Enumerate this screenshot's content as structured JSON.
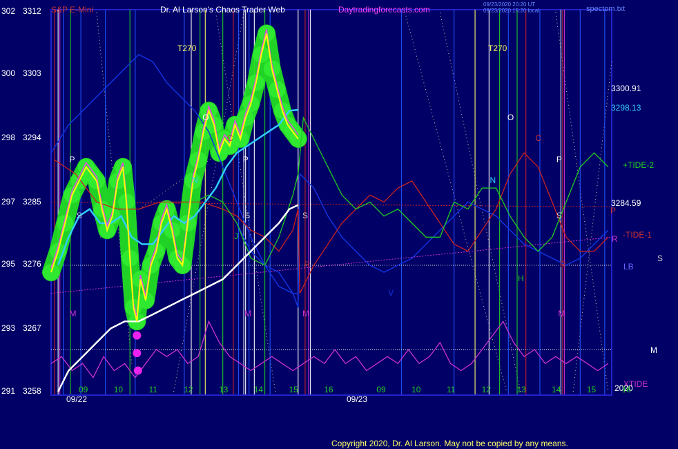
{
  "header": {
    "symbol": "S&P E-Mini",
    "title": "Dr. Al Larson's Chaos Trader Web",
    "site": "Daytradingforecasts.com",
    "timestamp_utc": "09/23/2020 20:20 UT",
    "timestamp_local": "09/23/2020 15:20 local",
    "chart_file": "spectom.txt"
  },
  "footer": {
    "copyright": "Copyright 2020, Dr. Al Larson. May not be copied by any means."
  },
  "colors": {
    "background": "#000066",
    "frame": "#2222cc",
    "price_line": "#ffff00",
    "price_glow": "#22dd22",
    "fast_ma": "#33ccff",
    "slow_ma": "#ffffff",
    "tide_green": "#22cc22",
    "tide_red": "#cc2222",
    "tide_magenta": "#cc33cc",
    "blue_curve": "#1133dd"
  },
  "chart_data": {
    "type": "line",
    "title": "S&P E-Mini",
    "ylim": [
      3258,
      3312
    ],
    "y_ticks": [
      {
        "left": "302",
        "right": "3312",
        "value": 3312
      },
      {
        "left": "300",
        "right": "3303",
        "value": 3303
      },
      {
        "left": "298",
        "right": "3294",
        "value": 3294
      },
      {
        "left": "297",
        "right": "3285",
        "value": 3285
      },
      {
        "left": "295",
        "right": "3276",
        "value": 3276
      },
      {
        "left": "293",
        "right": "3267",
        "value": 3267
      },
      {
        "left": "291",
        "right": "3258",
        "value": 3258
      }
    ],
    "x_ticks": [
      {
        "label": "09",
        "x": 8.5
      },
      {
        "label": "10",
        "x": 9.5
      },
      {
        "label": "11",
        "x": 10.5
      },
      {
        "label": "12",
        "x": 11.5
      },
      {
        "label": "13",
        "x": 12.5
      },
      {
        "label": "14",
        "x": 13.5
      },
      {
        "label": "15",
        "x": 14.5
      },
      {
        "label": "16",
        "x": 15.5
      },
      {
        "label": "09",
        "x": 17
      },
      {
        "label": "10",
        "x": 18
      },
      {
        "label": "11",
        "x": 19
      },
      {
        "label": "12",
        "x": 20
      },
      {
        "label": "13",
        "x": 21
      },
      {
        "label": "14",
        "x": 22
      },
      {
        "label": "15",
        "x": 23
      },
      {
        "label": "16",
        "x": 24
      }
    ],
    "date_labels": [
      {
        "label": "09/22",
        "x": 8.5
      },
      {
        "label": "09/23",
        "x": 17
      }
    ],
    "year_label": "2020",
    "xlim": [
      8.5,
      24.5
    ],
    "price_series": {
      "name": "S&P E-Mini",
      "x": [
        8.5,
        8.7,
        8.9,
        9.1,
        9.3,
        9.5,
        9.65,
        9.8,
        9.95,
        10.1,
        10.25,
        10.4,
        10.55,
        10.65,
        10.75,
        10.85,
        10.95,
        11.05,
        11.2,
        11.35,
        11.5,
        11.65,
        11.8,
        11.95,
        12.1,
        12.25,
        12.4,
        12.55,
        12.7,
        12.85,
        13.0,
        13.15,
        13.3,
        13.45,
        13.6,
        13.75,
        13.9,
        14.05,
        14.2,
        14.35,
        14.5,
        14.65,
        14.8,
        14.95,
        15.1,
        15.25,
        15.4,
        15.55
      ],
      "values": [
        3275,
        3278,
        3282,
        3286,
        3288,
        3290,
        3289,
        3288,
        3284,
        3281,
        3283,
        3288,
        3290,
        3285,
        3277,
        3270,
        3268,
        3274,
        3271,
        3276,
        3278,
        3282,
        3284,
        3281,
        3277,
        3276,
        3282,
        3288,
        3291,
        3295,
        3298,
        3296,
        3292,
        3294,
        3293,
        3296,
        3294,
        3297,
        3299,
        3302,
        3306,
        3309,
        3304,
        3301,
        3298,
        3296,
        3295,
        3294
      ]
    },
    "fast_ma": {
      "name": "3298.13",
      "x": [
        8.7,
        9.0,
        9.3,
        9.6,
        9.9,
        10.2,
        10.5,
        10.8,
        11.1,
        11.4,
        11.7,
        12.0,
        12.3,
        12.6,
        12.9,
        13.2,
        13.5,
        13.8,
        14.1,
        14.4,
        14.7,
        15.0,
        15.3,
        15.55
      ],
      "values": [
        3276,
        3280,
        3283,
        3284,
        3282,
        3282,
        3283,
        3280,
        3279,
        3279,
        3281,
        3283,
        3282,
        3283,
        3285,
        3287,
        3290,
        3292,
        3293,
        3294,
        3295,
        3296,
        3298,
        3298.13
      ]
    },
    "slow_ma": {
      "name": "3284.59",
      "x": [
        8.7,
        9.0,
        9.4,
        9.8,
        10.2,
        10.6,
        11.0,
        11.4,
        11.8,
        12.2,
        12.6,
        13.0,
        13.4,
        13.8,
        14.2,
        14.6,
        15.0,
        15.3,
        15.55
      ],
      "values": [
        3258,
        3261,
        3263,
        3265,
        3267,
        3268,
        3268,
        3269,
        3270,
        3271,
        3272,
        3273,
        3274,
        3276,
        3278,
        3280,
        3282,
        3284,
        3284.59
      ]
    },
    "annotations": [
      {
        "text": "3300.91",
        "color": "#ffffff"
      },
      {
        "text": "3298.13",
        "color": "#33ccff"
      },
      {
        "text": "3284.59",
        "color": "#ffffff"
      },
      {
        "text": "+TIDE-2",
        "color": "#22cc22"
      },
      {
        "text": "-TIDE-1",
        "color": "#cc3333"
      },
      {
        "text": "XTIDE",
        "color": "#cc33cc"
      },
      {
        "text": "LB",
        "color": "#6666ff"
      },
      {
        "text": "S",
        "color": "#cccccc"
      },
      {
        "text": "P",
        "color": "#ffffff"
      },
      {
        "text": "R",
        "color": "#cc3333"
      },
      {
        "text": "M",
        "color": "#cc33cc"
      },
      {
        "text": "T270",
        "color": "#ffff66"
      },
      {
        "text": "T270",
        "color": "#ffff66"
      }
    ],
    "markers": [
      {
        "text": "P",
        "x": 9.1,
        "y": 3291,
        "color": "#ffffff"
      },
      {
        "text": "S",
        "x": 9.3,
        "y": 3283,
        "color": "#cccccc"
      },
      {
        "text": "M",
        "x": 9.1,
        "y": 3269,
        "color": "#cc33cc"
      },
      {
        "text": "O",
        "x": 12.9,
        "y": 3297,
        "color": "#ffffff"
      },
      {
        "text": "N",
        "x": 12.6,
        "y": 3288,
        "color": "#33ccff"
      },
      {
        "text": "C",
        "x": 13.6,
        "y": 3294,
        "color": "#cc3333"
      },
      {
        "text": "P",
        "x": 14.05,
        "y": 3291,
        "color": "#ffffff"
      },
      {
        "text": "S",
        "x": 14.1,
        "y": 3283,
        "color": "#cccccc"
      },
      {
        "text": "J",
        "x": 13.8,
        "y": 3280,
        "color": "#22cc22"
      },
      {
        "text": "M",
        "x": 14.1,
        "y": 3269,
        "color": "#cc33cc"
      },
      {
        "text": "S",
        "x": 15.75,
        "y": 3283,
        "color": "#cccccc"
      },
      {
        "text": "M",
        "x": 15.75,
        "y": 3269,
        "color": "#cc33cc"
      },
      {
        "text": "R",
        "x": 15.8,
        "y": 3276,
        "color": "#cc3333"
      },
      {
        "text": "V",
        "x": 18.2,
        "y": 3272,
        "color": "#1133dd"
      },
      {
        "text": "O",
        "x": 21.6,
        "y": 3297,
        "color": "#ffffff"
      },
      {
        "text": "N",
        "x": 21.1,
        "y": 3288,
        "color": "#33ccff"
      },
      {
        "text": "C",
        "x": 22.4,
        "y": 3294,
        "color": "#cc3333"
      },
      {
        "text": "H",
        "x": 21.9,
        "y": 3274,
        "color": "#22cc22"
      },
      {
        "text": "P",
        "x": 23.0,
        "y": 3291,
        "color": "#ffffff"
      },
      {
        "text": "S",
        "x": 23.0,
        "y": 3283,
        "color": "#cccccc"
      },
      {
        "text": "R",
        "x": 23.1,
        "y": 3276,
        "color": "#cc3333"
      },
      {
        "text": "M",
        "x": 23.05,
        "y": 3269,
        "color": "#cc33cc"
      }
    ],
    "tide_green": {
      "name": "+TIDE-2",
      "x": [
        12.6,
        13.0,
        13.4,
        13.8,
        14.2,
        14.6,
        15.0,
        15.4,
        15.55,
        15.7,
        16.0,
        16.4,
        16.8,
        17.2,
        17.6,
        18.0,
        18.4,
        18.8,
        19.2,
        19.6,
        20.0,
        20.4,
        20.8,
        21.2,
        21.6,
        22.0,
        22.4,
        22.8,
        23.2,
        23.6,
        24.0,
        24.4
      ],
      "values": [
        3285,
        3286,
        3285,
        3282,
        3277,
        3276,
        3280,
        3286,
        3289,
        3297,
        3294,
        3290,
        3286,
        3284,
        3285,
        3283,
        3284,
        3282,
        3280,
        3280,
        3285,
        3284,
        3287,
        3287,
        3283,
        3280,
        3278,
        3280,
        3285,
        3290,
        3292,
        3290
      ]
    },
    "tide_red": {
      "name": "-TIDE-1",
      "x": [
        8.6,
        9.2,
        9.8,
        10.4,
        11.0,
        11.6,
        12.2,
        12.8,
        13.4,
        13.8,
        14.2,
        14.6,
        15.0,
        15.4,
        15.55,
        15.6,
        16.0,
        16.4,
        16.8,
        17.2,
        17.6,
        18.0,
        18.4,
        18.8,
        19.2,
        19.6,
        20.0,
        20.4,
        20.8,
        21.2,
        21.6,
        22.0,
        22.4,
        22.8,
        23.2,
        23.6,
        24.0,
        24.4
      ],
      "values": [
        3291,
        3289,
        3285,
        3284,
        3284,
        3285,
        3285,
        3285,
        3284,
        3283,
        3281,
        3280,
        3278,
        3281,
        3284,
        3272,
        3276,
        3279,
        3282,
        3284,
        3286,
        3285,
        3287,
        3288,
        3285,
        3282,
        3279,
        3278,
        3281,
        3284,
        3289,
        3292,
        3290,
        3285,
        3280,
        3278,
        3278,
        3280
      ]
    },
    "xtide": {
      "name": "XTIDE",
      "x": [
        8.5,
        8.8,
        9.1,
        9.4,
        9.7,
        10.0,
        10.3,
        10.6,
        10.9,
        11.2,
        11.5,
        11.8,
        12.1,
        12.4,
        12.7,
        13.0,
        13.3,
        13.6,
        13.9,
        14.2,
        14.5,
        14.8,
        15.1,
        15.4,
        15.7,
        16.0,
        16.3,
        16.6,
        16.9,
        17.2,
        17.5,
        17.8,
        18.1,
        18.4,
        18.7,
        19.0,
        19.3,
        19.6,
        19.9,
        20.2,
        20.5,
        20.8,
        21.1,
        21.4,
        21.7,
        22.0,
        22.3,
        22.6,
        22.9,
        23.2,
        23.5,
        23.8,
        24.1,
        24.4
      ],
      "values": [
        3262,
        3263,
        3261,
        3262,
        3260,
        3263,
        3261,
        3262,
        3260,
        3262,
        3264,
        3263,
        3264,
        3262,
        3263,
        3268,
        3265,
        3263,
        3262,
        3261,
        3262,
        3263,
        3262,
        3261,
        3262,
        3263,
        3262,
        3264,
        3262,
        3263,
        3261,
        3262,
        3263,
        3262,
        3264,
        3262,
        3263,
        3265,
        3262,
        3261,
        3262,
        3264,
        3266,
        3268,
        3265,
        3263,
        3264,
        3262,
        3263,
        3262,
        3263,
        3262,
        3261,
        3262
      ]
    },
    "blue_curve": {
      "x": [
        8.5,
        9.0,
        9.6,
        10.2,
        10.6,
        11.0,
        11.4,
        11.8,
        12.2,
        12.6,
        13.0,
        13.4,
        13.8,
        14.2,
        14.6,
        15.0,
        15.4,
        15.55
      ],
      "values": [
        3292,
        3296,
        3299,
        3302,
        3304,
        3306,
        3305,
        3302,
        3300,
        3298,
        3295,
        3290,
        3285,
        3280,
        3276,
        3273,
        3272,
        3272
      ],
      "extra_x": [
        13.8,
        14.2,
        14.6,
        15.0,
        15.4,
        15.55,
        15.6,
        16.0,
        16.4,
        16.8,
        17.2,
        17.6,
        18.0,
        18.4,
        18.8,
        19.2,
        19.6,
        20.0,
        20.4,
        20.8,
        21.2,
        21.6,
        22.0,
        22.4,
        22.8,
        23.2,
        23.6,
        24.0,
        24.4
      ],
      "extra_values": [
        3282,
        3278,
        3276,
        3275,
        3272,
        3270,
        3289,
        3287,
        3283,
        3280,
        3278,
        3276,
        3275,
        3276,
        3277,
        3279,
        3281,
        3283,
        3285,
        3284,
        3283,
        3281,
        3279,
        3278,
        3277,
        3276,
        3277,
        3279,
        3281
      ]
    },
    "ref_lines": [
      {
        "y0": 3285,
        "y1": 3284.3,
        "color": "#cc2222",
        "dash": "2,2"
      },
      {
        "y0": 3272,
        "y1": 3280,
        "color": "#cc33cc",
        "dash": "2,2"
      },
      {
        "y0": 3276,
        "y1": 3276,
        "color": "#dddddd",
        "dash": "1,2"
      },
      {
        "y0": 3264,
        "y1": 3264,
        "color": "#ffffff",
        "dash": "1,2"
      }
    ],
    "vlines": [
      {
        "x": 8.6,
        "color": "#cc2222"
      },
      {
        "x": 8.7,
        "color": "#ffffff"
      },
      {
        "x": 8.75,
        "color": "#cc33cc"
      },
      {
        "x": 8.85,
        "color": "#2255ff"
      },
      {
        "x": 9.05,
        "color": "#22cc22"
      },
      {
        "x": 9.35,
        "color": "#2255ff"
      },
      {
        "x": 10.05,
        "color": "#2255ff"
      },
      {
        "x": 10.75,
        "color": "#22cc22"
      },
      {
        "x": 10.9,
        "color": "#2255ff"
      },
      {
        "x": 12.3,
        "color": "#2255ff"
      },
      {
        "x": 12.5,
        "color": "#ffffff"
      },
      {
        "x": 12.75,
        "color": "#22cc22"
      },
      {
        "x": 12.9,
        "color": "#ffff66"
      },
      {
        "x": 13.4,
        "color": "#22cc22"
      },
      {
        "x": 13.7,
        "color": "#cc2222"
      },
      {
        "x": 13.85,
        "color": "#2255ff"
      },
      {
        "x": 14.0,
        "color": "#ffffff"
      },
      {
        "x": 14.05,
        "color": "#ffffff"
      },
      {
        "x": 14.15,
        "color": "#2255ff"
      },
      {
        "x": 14.3,
        "color": "#ffffff"
      },
      {
        "x": 14.6,
        "color": "#22cc22"
      },
      {
        "x": 14.75,
        "color": "#2255ff"
      },
      {
        "x": 15.55,
        "color": "#ffffff"
      },
      {
        "x": 15.75,
        "color": "#cc2222"
      },
      {
        "x": 15.85,
        "color": "#cc33cc"
      },
      {
        "x": 15.9,
        "color": "#ffffff"
      },
      {
        "x": 18.5,
        "color": "#2255ff"
      },
      {
        "x": 20.0,
        "color": "#2255ff"
      },
      {
        "x": 20.6,
        "color": "#ffff66"
      },
      {
        "x": 21.0,
        "color": "#ffffff"
      },
      {
        "x": 21.3,
        "color": "#22cc22"
      },
      {
        "x": 21.55,
        "color": "#2255ff"
      },
      {
        "x": 21.8,
        "color": "#22cc22"
      },
      {
        "x": 22.05,
        "color": "#cc2222"
      },
      {
        "x": 22.45,
        "color": "#2255ff"
      },
      {
        "x": 23.05,
        "color": "#ffffff"
      },
      {
        "x": 23.1,
        "color": "#cc2222"
      },
      {
        "x": 23.15,
        "color": "#cc33cc"
      },
      {
        "x": 23.6,
        "color": "#2255ff"
      },
      {
        "x": 24.3,
        "color": "#2255ff"
      }
    ],
    "t270_marks": [
      12.5,
      21.4
    ],
    "grid": true,
    "legend": "right"
  }
}
